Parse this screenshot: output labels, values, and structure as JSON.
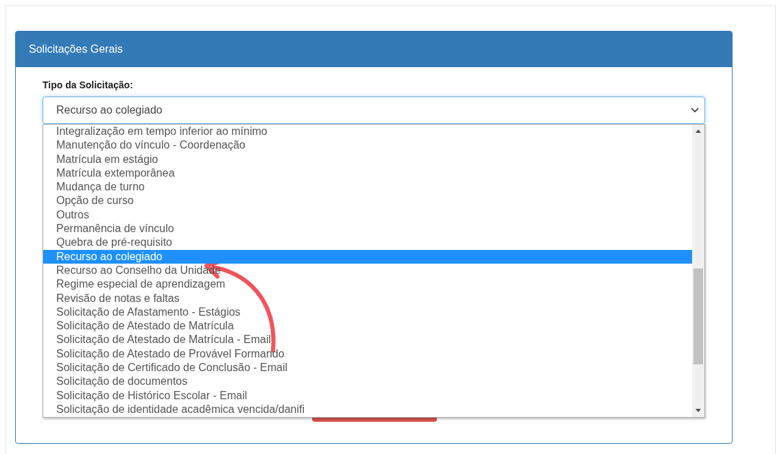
{
  "panel": {
    "title": "Solicitações Gerais"
  },
  "field": {
    "label": "Tipo da Solicitação:",
    "value": "Recurso ao colegiado"
  },
  "options": [
    {
      "label": "Integralização em tempo inferior ao mínimo",
      "selected": false
    },
    {
      "label": "Manutenção do vínculo - Coordenação",
      "selected": false
    },
    {
      "label": "Matrícula em estágio",
      "selected": false
    },
    {
      "label": "Matrícula extemporânea",
      "selected": false
    },
    {
      "label": "Mudança de turno",
      "selected": false
    },
    {
      "label": "Opção de curso",
      "selected": false
    },
    {
      "label": "Outros",
      "selected": false
    },
    {
      "label": "Permanência de vínculo",
      "selected": false
    },
    {
      "label": "Quebra de pré-requisito",
      "selected": false
    },
    {
      "label": "Recurso ao colegiado",
      "selected": true
    },
    {
      "label": "Recurso ao Conselho da Unidade",
      "selected": false
    },
    {
      "label": "Regime especial de aprendizagem",
      "selected": false
    },
    {
      "label": "Revisão de notas e faltas",
      "selected": false
    },
    {
      "label": "Solicitação de Afastamento - Estágios",
      "selected": false
    },
    {
      "label": "Solicitação de Atestado de Matrícula",
      "selected": false
    },
    {
      "label": "Solicitação de Atestado de Matrícula - Email",
      "selected": false
    },
    {
      "label": "Solicitação de Atestado de Provável Formando",
      "selected": false
    },
    {
      "label": "Solicitação de Certificado de Conclusão - Email",
      "selected": false
    },
    {
      "label": "Solicitação de documentos",
      "selected": false
    },
    {
      "label": "Solicitação de Histórico Escolar - Email",
      "selected": false
    },
    {
      "label": "Solicitação de identidade acadêmica vencida/danifi",
      "selected": false
    }
  ]
}
